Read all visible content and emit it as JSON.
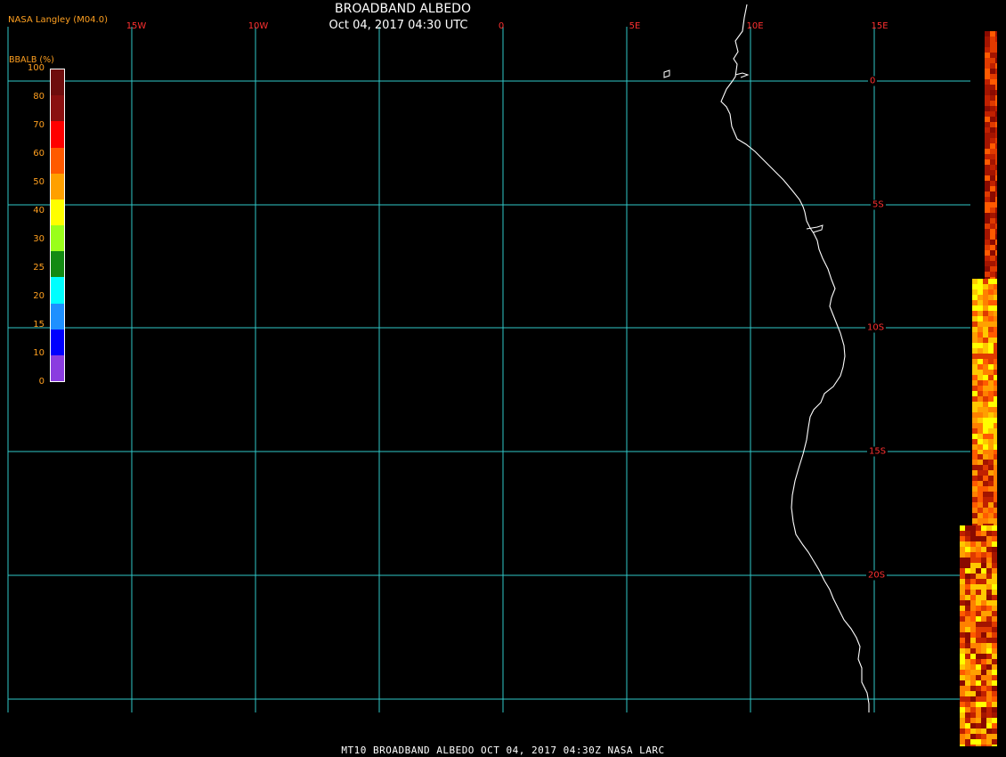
{
  "header": {
    "credit": "NASA Langley (M04.0)",
    "title": "BROADBAND ALBEDO",
    "datetime": "Oct 04, 2017 04:30 UTC"
  },
  "footer": {
    "caption": "MT10  BROADBAND ALBEDO   OCT 04, 2017 04:30Z   NASA LARC"
  },
  "colorbar": {
    "title": "BBALB (%)",
    "ticks": [
      "100",
      "80",
      "70",
      "60",
      "50",
      "40",
      "30",
      "25",
      "20",
      "15",
      "10",
      "0"
    ],
    "colors": [
      "#6e0d0d",
      "#8a1010",
      "#ff0000",
      "#ff5a00",
      "#ffa000",
      "#ffff00",
      "#9aff1a",
      "#138a13",
      "#00ffff",
      "#1e90ff",
      "#0000ff",
      "#8b3de0"
    ]
  },
  "grid": {
    "lon_labels": [
      "15W",
      "10W",
      "5W",
      "0",
      "5E",
      "10E",
      "15E"
    ],
    "lat_labels": [
      "0",
      "5S",
      "10S",
      "15S",
      "20S"
    ],
    "grid_color": "#30c8c8",
    "coast_color": "#ffffff"
  }
}
